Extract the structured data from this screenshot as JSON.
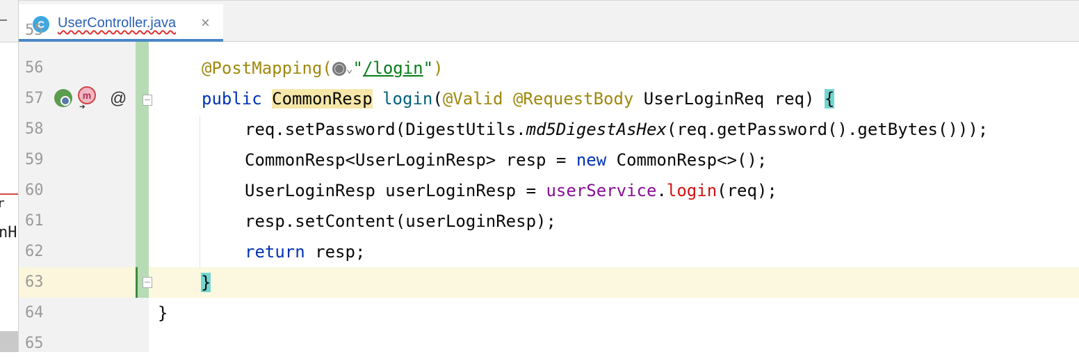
{
  "tab": {
    "icon_letter": "C",
    "title": "UserController.java",
    "close": "×"
  },
  "left_panel": {
    "cut_text_1": "r",
    "cut_text_2": "nH"
  },
  "gutter": {
    "partial_top": "55",
    "line_numbers": [
      "56",
      "57",
      "58",
      "59",
      "60",
      "61",
      "62",
      "63",
      "64",
      "65"
    ],
    "icons": {
      "mapping_icon": "spring-web-endpoint-icon",
      "override_icon": "m",
      "annotation_icon": "@"
    }
  },
  "code": {
    "line56": {
      "ann": "@PostMapping(",
      "str_open": "\"",
      "url": "/login",
      "str_close": "\"",
      "close": ")"
    },
    "line57": {
      "kw": "public",
      "type": "CommonResp",
      "fn": "login",
      "open": "(",
      "ann1": "@Valid",
      "ann2": "@RequestBody",
      "rest": " UserLoginReq req) ",
      "brace": "{"
    },
    "line58": {
      "a": "req.setPassword(DigestUtils.",
      "b": "md5DigestAsHex",
      "c": "(req.getPassword().getBytes()));"
    },
    "line59": {
      "a": "CommonResp<UserLoginResp> resp = ",
      "kw": "new",
      "b": " CommonResp<>();"
    },
    "line60": {
      "a": "UserLoginResp userLoginResp = ",
      "field": "userService",
      "dot": ".",
      "call": "login",
      "b": "(req);"
    },
    "line61": {
      "a": "resp.setContent(userLoginResp);"
    },
    "line62": {
      "kw": "return",
      "b": " resp;"
    },
    "line63": {
      "brace": "}"
    },
    "line64": {
      "brace": "}"
    }
  },
  "colors": {
    "annotation": "#9e880d",
    "keyword": "#0033b3",
    "string": "#067d17",
    "field": "#871094",
    "method": "#00627a"
  }
}
